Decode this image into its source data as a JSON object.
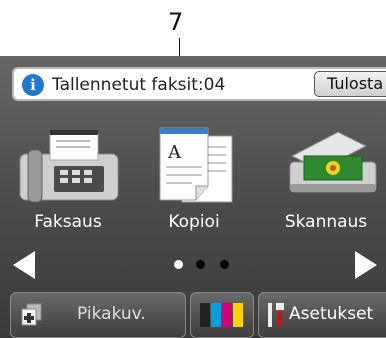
{
  "callout": {
    "number": "7"
  },
  "notice": {
    "icon": "info-icon",
    "text": "Tallennetut faksit:04",
    "button_label": "Tulosta"
  },
  "apps": [
    {
      "label": "Faksaus",
      "icon": "fax-icon"
    },
    {
      "label": "Kopioi",
      "icon": "copy-icon"
    },
    {
      "label": "Skannaus",
      "icon": "scanner-icon"
    }
  ],
  "pager": {
    "total_pages": 3,
    "current_page": 1
  },
  "bottom_bar": {
    "shortcuts_label": "Pikakuv.",
    "settings_label": "Asetukset",
    "ink_colors": [
      "#222222",
      "#00a0e0",
      "#d4007a",
      "#ffd400"
    ]
  },
  "colors": {
    "info": "#1f78d0",
    "accent_red": "#d01010"
  }
}
